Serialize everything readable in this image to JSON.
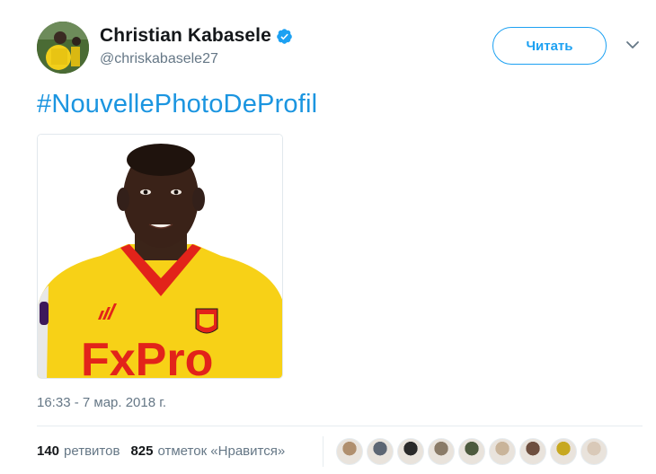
{
  "tweet": {
    "author": {
      "display_name": "Christian Kabasele",
      "handle": "@chriskabasele27",
      "verified": true,
      "avatar_icon": "avatar-photo"
    },
    "follow_button_label": "Читать",
    "text": "#NouvellePhotoDeProfil",
    "timestamp": "16:33 - 7 мар. 2018 г.",
    "retweets": {
      "count": "140",
      "label": "ретвитов"
    },
    "likes": {
      "count": "825",
      "label": "отметок «Нравится»"
    },
    "liker_avatars": [
      {
        "color": "#b08f6e"
      },
      {
        "color": "#5d6673"
      },
      {
        "color": "#2a2a2a"
      },
      {
        "color": "#8a7b68"
      },
      {
        "color": "#4d5a3e"
      },
      {
        "color": "#c9b49a"
      },
      {
        "color": "#6e4f3f"
      },
      {
        "color": "#c7a820"
      },
      {
        "color": "#d9c9b8"
      }
    ]
  },
  "colors": {
    "accent": "#1da1f2",
    "hashtag": "#1b95e0",
    "secondary_text": "#657786",
    "jersey_yellow": "#f7d117",
    "jersey_red": "#e2231a"
  }
}
